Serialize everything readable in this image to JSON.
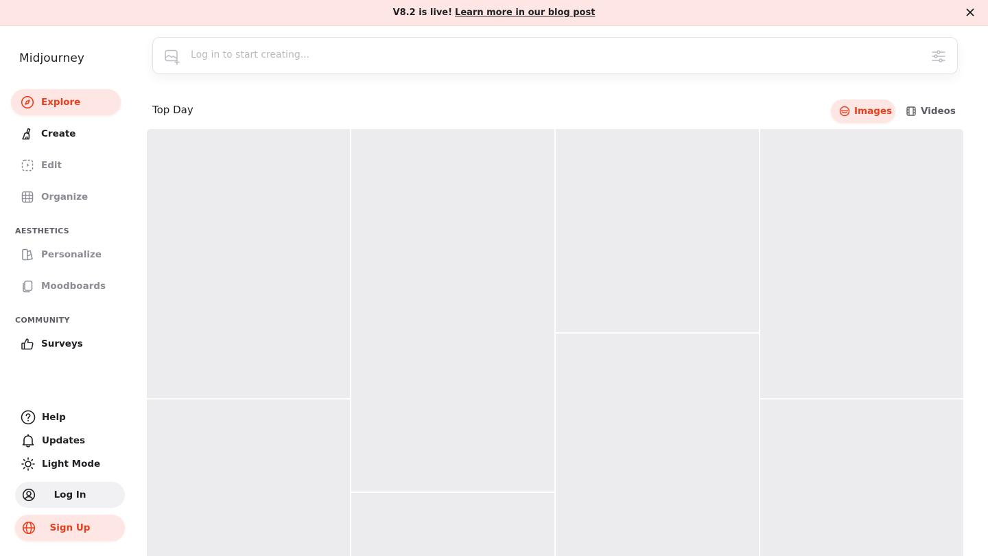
{
  "banner": {
    "text": "V8.2 is live!",
    "link_text": "Learn more in our blog post"
  },
  "sidebar": {
    "brand": "Midjourney",
    "nav": [
      {
        "label": "Explore",
        "icon": "compass-icon",
        "state": "active"
      },
      {
        "label": "Create",
        "icon": "brush-icon",
        "state": "enabled"
      },
      {
        "label": "Edit",
        "icon": "edit-frame-icon",
        "state": "disabled"
      },
      {
        "label": "Organize",
        "icon": "grid-icon",
        "state": "disabled"
      }
    ],
    "aesthetics_label": "AESTHETICS",
    "aesthetics": [
      {
        "label": "Personalize",
        "icon": "palette-icon",
        "state": "disabled"
      },
      {
        "label": "Moodboards",
        "icon": "cards-icon",
        "state": "disabled"
      }
    ],
    "community_label": "COMMUNITY",
    "community": [
      {
        "label": "Surveys",
        "icon": "thumbs-up-icon",
        "state": "enabled"
      }
    ],
    "bottom": [
      {
        "label": "Help",
        "icon": "help-circle-icon"
      },
      {
        "label": "Updates",
        "icon": "bell-icon"
      },
      {
        "label": "Light Mode",
        "icon": "sun-icon"
      }
    ],
    "login_label": "Log In",
    "signup_label": "Sign Up"
  },
  "prompt": {
    "placeholder": "Log in to start creating..."
  },
  "feed": {
    "title": "Top Day",
    "toggle_images": "Images",
    "toggle_videos": "Videos",
    "active_toggle": "Images"
  },
  "colors": {
    "accent": "#e8401c",
    "accent_bg": "#fde6e3",
    "tile": "#ececee",
    "muted_text": "#8a8d94"
  }
}
